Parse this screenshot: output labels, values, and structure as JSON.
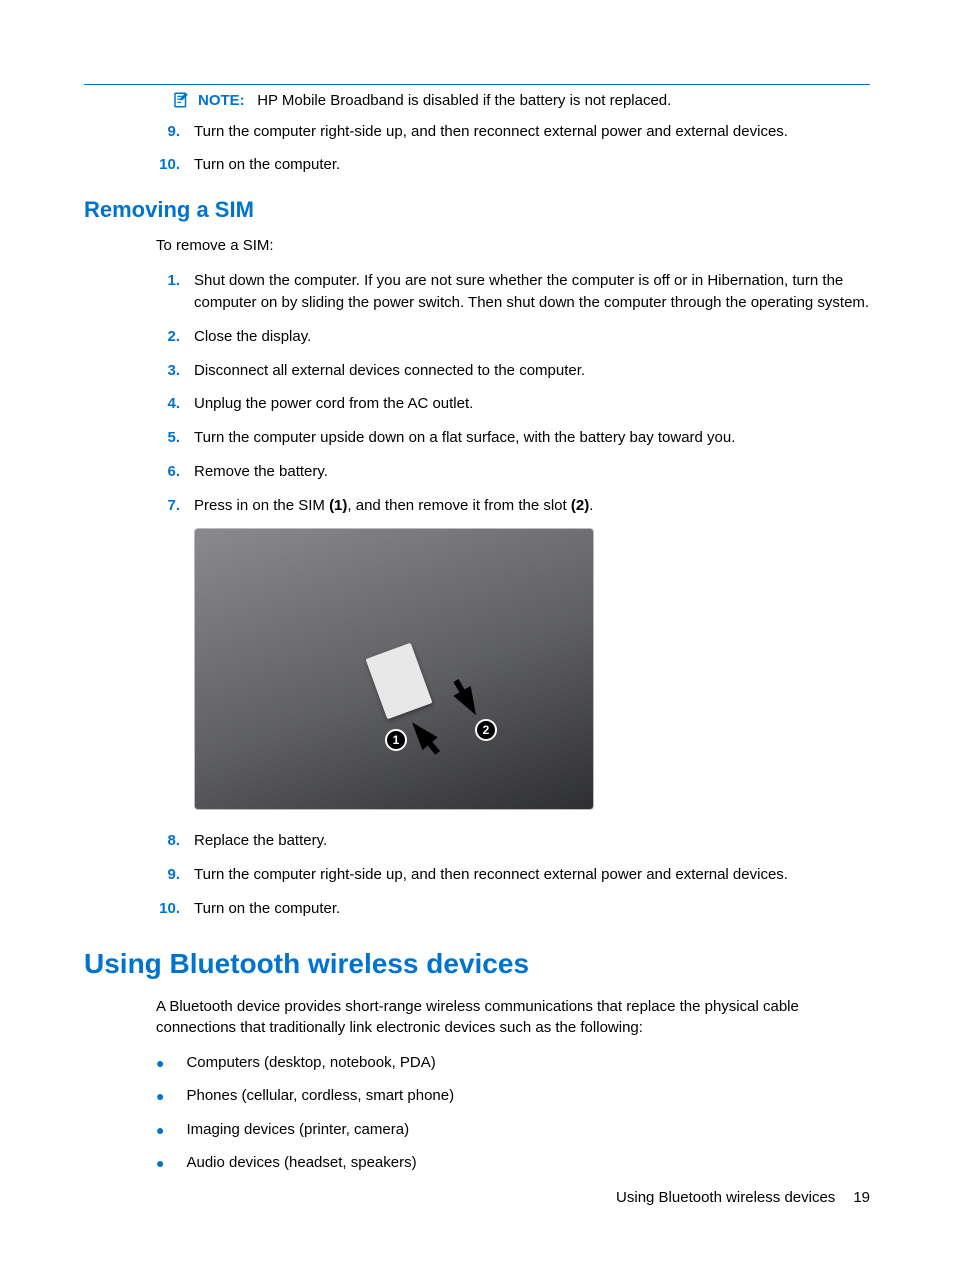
{
  "note": {
    "label": "NOTE:",
    "text": "HP Mobile Broadband is disabled if the battery is not replaced."
  },
  "top_steps": [
    {
      "num": "9.",
      "text": "Turn the computer right-side up, and then reconnect external power and external devices."
    },
    {
      "num": "10.",
      "text": "Turn on the computer."
    }
  ],
  "section_removing": {
    "title": "Removing a SIM",
    "intro": "To remove a SIM:",
    "steps_a": [
      {
        "num": "1.",
        "text": "Shut down the computer. If you are not sure whether the computer is off or in Hibernation, turn the computer on by sliding the power switch. Then shut down the computer through the operating system."
      },
      {
        "num": "2.",
        "text": "Close the display."
      },
      {
        "num": "3.",
        "text": "Disconnect all external devices connected to the computer."
      },
      {
        "num": "4.",
        "text": "Unplug the power cord from the AC outlet."
      },
      {
        "num": "5.",
        "text": "Turn the computer upside down on a flat surface, with the battery bay toward you."
      },
      {
        "num": "6.",
        "text": "Remove the battery."
      }
    ],
    "step7": {
      "num": "7.",
      "pre": "Press in on the SIM ",
      "b1": "(1)",
      "mid": ", and then remove it from the slot ",
      "b2": "(2)",
      "post": "."
    },
    "image_badges": {
      "b1": "1",
      "b2": "2"
    },
    "steps_b": [
      {
        "num": "8.",
        "text": "Replace the battery."
      },
      {
        "num": "9.",
        "text": "Turn the computer right-side up, and then reconnect external power and external devices."
      },
      {
        "num": "10.",
        "text": "Turn on the computer."
      }
    ]
  },
  "section_bluetooth": {
    "title": "Using Bluetooth wireless devices",
    "intro": "A Bluetooth device provides short-range wireless communications that replace the physical cable connections that traditionally link electronic devices such as the following:",
    "items": [
      "Computers (desktop, notebook, PDA)",
      "Phones (cellular, cordless, smart phone)",
      "Imaging devices (printer, camera)",
      "Audio devices (headset, speakers)"
    ]
  },
  "footer": {
    "section": "Using Bluetooth wireless devices",
    "page": "19"
  }
}
